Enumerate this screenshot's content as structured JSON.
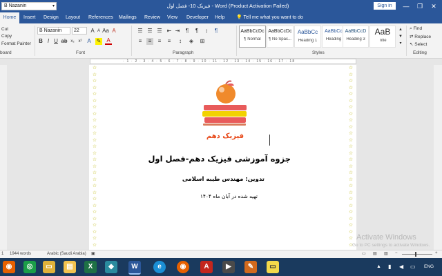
{
  "titlebar": {
    "font_name": "B Nazanin",
    "doc_title": "فیزیک 10- فصل اول  -  Word (Product Activation Failed)",
    "signin_label": "Sign in",
    "minimize": "—",
    "restore": "❐",
    "close": "✕"
  },
  "tabs": [
    {
      "label": "Home"
    },
    {
      "label": "Insert"
    },
    {
      "label": "Design"
    },
    {
      "label": "Layout"
    },
    {
      "label": "References"
    },
    {
      "label": "Mailings"
    },
    {
      "label": "Review"
    },
    {
      "label": "View"
    },
    {
      "label": "Developer"
    },
    {
      "label": "Help"
    }
  ],
  "tell_me": "Tell me what you want to do",
  "ribbon": {
    "clipboard": {
      "label": "board",
      "cut": "Cut",
      "copy": "Copy",
      "format_painter": "Format Painter"
    },
    "font": {
      "label": "Font",
      "name": "B Nazanin",
      "size": "22"
    },
    "paragraph": {
      "label": "Paragraph"
    },
    "styles": {
      "label": "Styles",
      "items": [
        {
          "preview": "AaBbCcDc",
          "name": "¶ Normal"
        },
        {
          "preview": "AaBbCcDc",
          "name": "¶ No Spac..."
        },
        {
          "preview": "AaBbCc",
          "name": "Heading 1"
        },
        {
          "preview": "AaBbCcC",
          "name": "Heading 2"
        },
        {
          "preview": "AaBbCcD",
          "name": "Heading 3"
        },
        {
          "preview": "AaB",
          "name": "Title"
        }
      ]
    },
    "editing": {
      "label": "Editing",
      "find": "Find",
      "replace": "Replace",
      "select": "Select"
    }
  },
  "ruler_text": "· 1 · 2 · 3 · 4 · 5 · 6 · 7 · 8 · 9 · 10 · 11 · 12 · 13 · 14 · 15 · 16 · 17 · 18",
  "document": {
    "logo_caption": "فیزیک دهم",
    "heading": "جزوه آموزشی فیزیک دهم-فصل اول",
    "author": "تدوین: مهندس طیبه اسلامی",
    "date": "تهیه شده در آبان ماه ۱۴۰۴"
  },
  "statusbar": {
    "page": "1",
    "words": "1944 words",
    "language": "Arabic (Saudi Arabia)"
  },
  "watermark": {
    "line1": "Activate Windows",
    "line2": "Go to PC settings to activate Windows."
  },
  "taskbar": {
    "lang": "ENG",
    "apps": [
      "firefox-icon",
      "chrome-icon",
      "explorer-icon",
      "files-icon",
      "excel-icon",
      "app-icon",
      "edge-icon",
      "word-icon",
      "edge-icon",
      "firefox-icon",
      "acrobat-icon",
      "media-icon",
      "paint-icon",
      "sticky-icon"
    ]
  },
  "colors": {
    "accent": "#2b579a",
    "taskbar": "#1a3a5e",
    "stars": "#b9b400",
    "heading": "#000000"
  }
}
